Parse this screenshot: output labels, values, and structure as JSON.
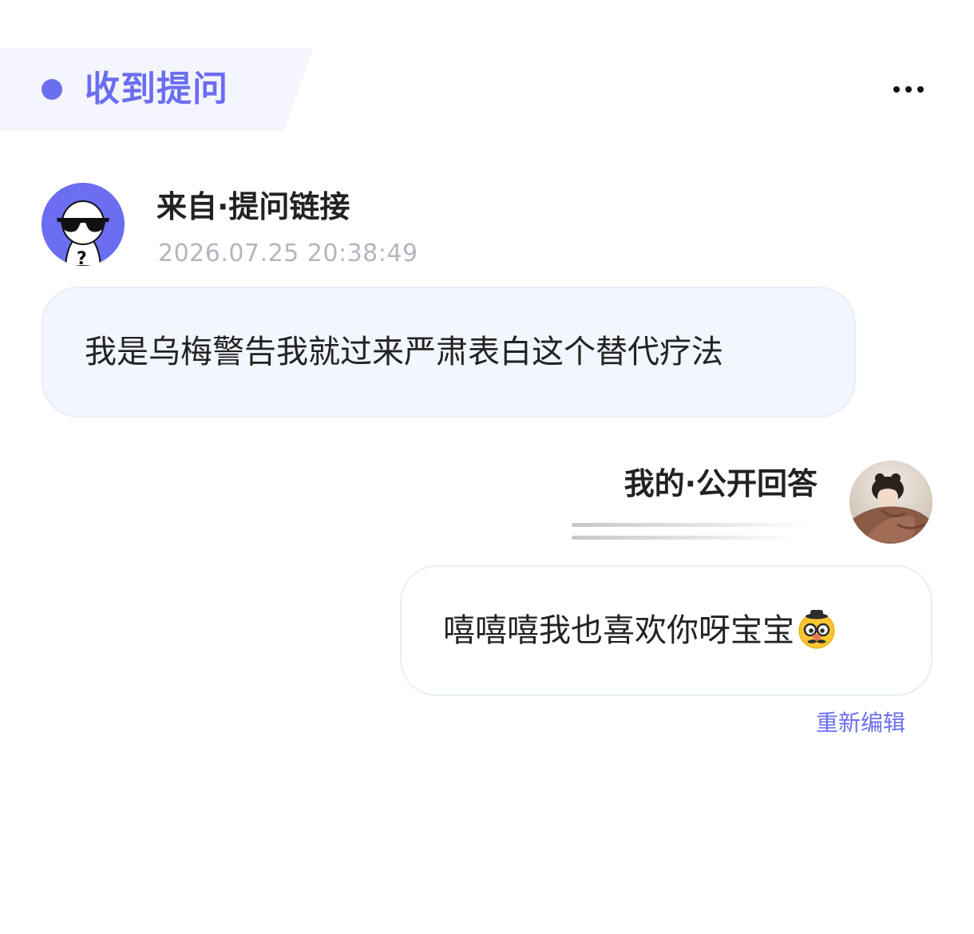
{
  "header": {
    "title": "收到提问"
  },
  "question": {
    "sender_label": "来自·提问链接",
    "timestamp": "2026.07.25 20:38:49",
    "text": "我是乌梅警告我就过来严肃表白这个替代疗法",
    "avatar_icon": "anonymous-sunglasses-avatar"
  },
  "answer": {
    "label": "我的·公开回答",
    "text": "嘻嘻嘻我也喜欢你呀宝宝",
    "emoji_icon": "disguised-face-emoji",
    "reedit_label": "重新编辑"
  },
  "colors": {
    "accent": "#6b6ef0",
    "question_bubble_bg": "#f2f6fd",
    "timestamp_text": "#b3b6bf",
    "header_bg": "#f5f5fe"
  }
}
